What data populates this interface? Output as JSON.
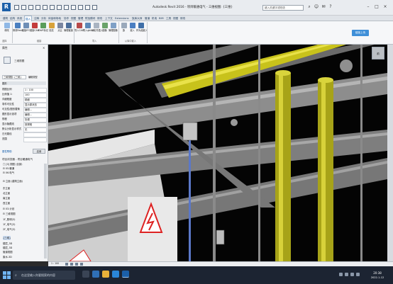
{
  "titlebar": {
    "title": "Autodesk Revit 2016 -     项目暖通电气 - 三维视图: {三维}",
    "search_placeholder": "键入关键字或短语"
  },
  "tabs": [
    "建筑",
    "结构",
    "系统",
    "插入",
    "注释",
    "分析",
    "体量和场地",
    "协作",
    "视图",
    "管理",
    "附加模块",
    "修改",
    "上下文",
    "Extensions",
    "族库大师",
    "管道",
    "机电",
    "BIM",
    "工具",
    "视图",
    "修改"
  ],
  "ribbon": {
    "buttons": [
      "修改",
      "修改Revit",
      "链接IFC",
      "链接CAD",
      "DWF标记",
      "贴花",
      "点云",
      "管理链接",
      "导入CAD",
      "导入gbXML",
      "从文件插入",
      "图像",
      "管理图像",
      "族",
      "载入",
      "作为组载入"
    ],
    "groups": [
      "选择",
      "链接",
      "导入",
      "从库中载入"
    ],
    "blue_button": "链接上传"
  },
  "left_panel": {
    "properties_title": "属性",
    "type_name": "三维视图",
    "view_selector": "三维视图: {三维}",
    "edit_type": "编辑类型",
    "section": "图形",
    "props": [
      {
        "k": "视图比例",
        "v": "1 : 100"
      },
      {
        "k": "比例值 1:",
        "v": "100"
      },
      {
        "k": "详细程度",
        "v": "精细"
      },
      {
        "k": "零件可见性",
        "v": "显示原状态"
      },
      {
        "k": "可见性/图形替换",
        "v": "编辑..."
      },
      {
        "k": "图形显示选项",
        "v": "编辑..."
      },
      {
        "k": "规程",
        "v": "协调"
      },
      {
        "k": "显示隐藏线",
        "v": "按规程"
      },
      {
        "k": "默认分析显示样式",
        "v": "无"
      },
      {
        "k": "日光路径",
        "v": ""
      },
      {
        "k": "范围",
        "v": ""
      }
    ],
    "help_link": "属性帮助",
    "apply": "应用",
    "browser_title": "项目浏览器 - 项目暖通电气",
    "tree": [
      "□ [0] 视图 (全部)",
      "  ⊟ 05.暖通",
      "  ⊟ 06.电气",
      "    ⊟ 立面 (建筑立面)",
      "      东立面",
      "      北立面",
      "      南立面",
      "      西立面",
      "  ⊟ 03.计划",
      "    ⊟ 三维视图",
      "      1F_照明(3)",
      "      1F_电气(3)",
      "      2F_电气(3)",
      "      {三维}",
      "      楼层_3D",
      "      楼层_3D",
      "      管道视图",
      "      废水-3D"
    ]
  },
  "view": {
    "viewcube_label": "前",
    "statusbar": "1 : 100"
  },
  "taskbar": {
    "search_text": "在这里输入你要搜索的内容",
    "time": "20:38",
    "date": "2022-1-12"
  }
}
